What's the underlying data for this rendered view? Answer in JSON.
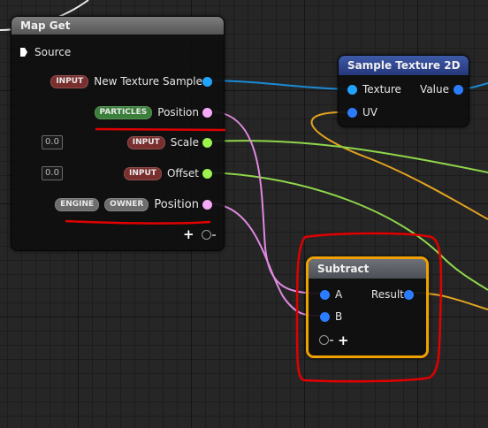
{
  "colors": {
    "wire_texture": "#1a8ad4",
    "wire_position": "#e089e0",
    "wire_vector": "#8fd64b",
    "wire_uv": "#e3a41f",
    "pin_texture": "#22a3ff",
    "pin_position": "#f7a8f7",
    "pin_vector": "#9cf24f",
    "pin_float": "#2b7cff",
    "annotation": "#e00000",
    "selection": "#f0a100"
  },
  "map_get": {
    "title": "Map Get",
    "source_label": "Source",
    "rows": [
      {
        "badges": [
          "INPUT"
        ],
        "label": "New Texture Sample"
      },
      {
        "badges": [
          "PARTICLES"
        ],
        "label": "Position"
      },
      {
        "badges": [
          "INPUT"
        ],
        "label": "Scale",
        "default_value": "0.0"
      },
      {
        "badges": [
          "INPUT"
        ],
        "label": "Offset",
        "default_value": "0.0"
      },
      {
        "badges": [
          "ENGINE",
          "OWNER"
        ],
        "label": "Position"
      }
    ],
    "add_symbol": "+"
  },
  "sample_texture": {
    "title": "Sample Texture 2D",
    "inputs": [
      "Texture",
      "UV"
    ],
    "output": "Value"
  },
  "subtract": {
    "title": "Subtract",
    "inputs": [
      "A",
      "B"
    ],
    "output": "Result",
    "add_symbol": "+"
  }
}
